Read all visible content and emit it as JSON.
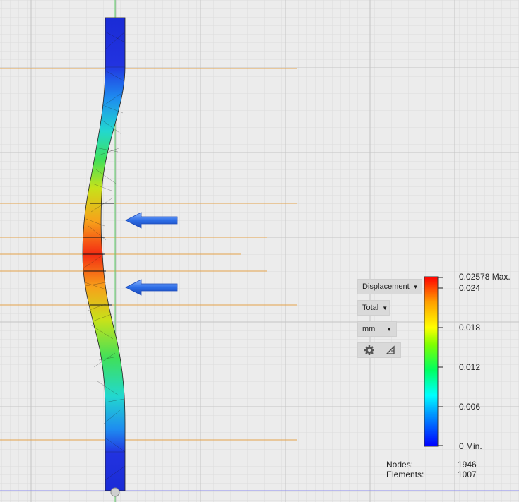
{
  "result_controls": {
    "type_label": "Displacement",
    "component_label": "Total",
    "unit_label": "mm",
    "settings_icon": "gear-icon",
    "probe_icon": "triangle-probe-icon"
  },
  "legend": {
    "max_value": "0.02578 Max.",
    "min_value": "0 Min.",
    "ticks": [
      {
        "label": "0.024",
        "value": 0.024
      },
      {
        "label": "0.018",
        "value": 0.018
      },
      {
        "label": "0.012",
        "value": 0.012
      },
      {
        "label": "0.006",
        "value": 0.006
      }
    ],
    "max_numeric": 0.02578,
    "colors": [
      "#0000ff",
      "#00a0ff",
      "#00ffff",
      "#00ff60",
      "#7fff00",
      "#ffff00",
      "#ffa000",
      "#ff0000"
    ]
  },
  "stats": {
    "nodes_label": "Nodes:",
    "nodes_value": "1946",
    "elements_label": "Elements:",
    "elements_value": "1007"
  },
  "load_arrows": [
    "arrow-icon",
    "arrow-icon"
  ]
}
